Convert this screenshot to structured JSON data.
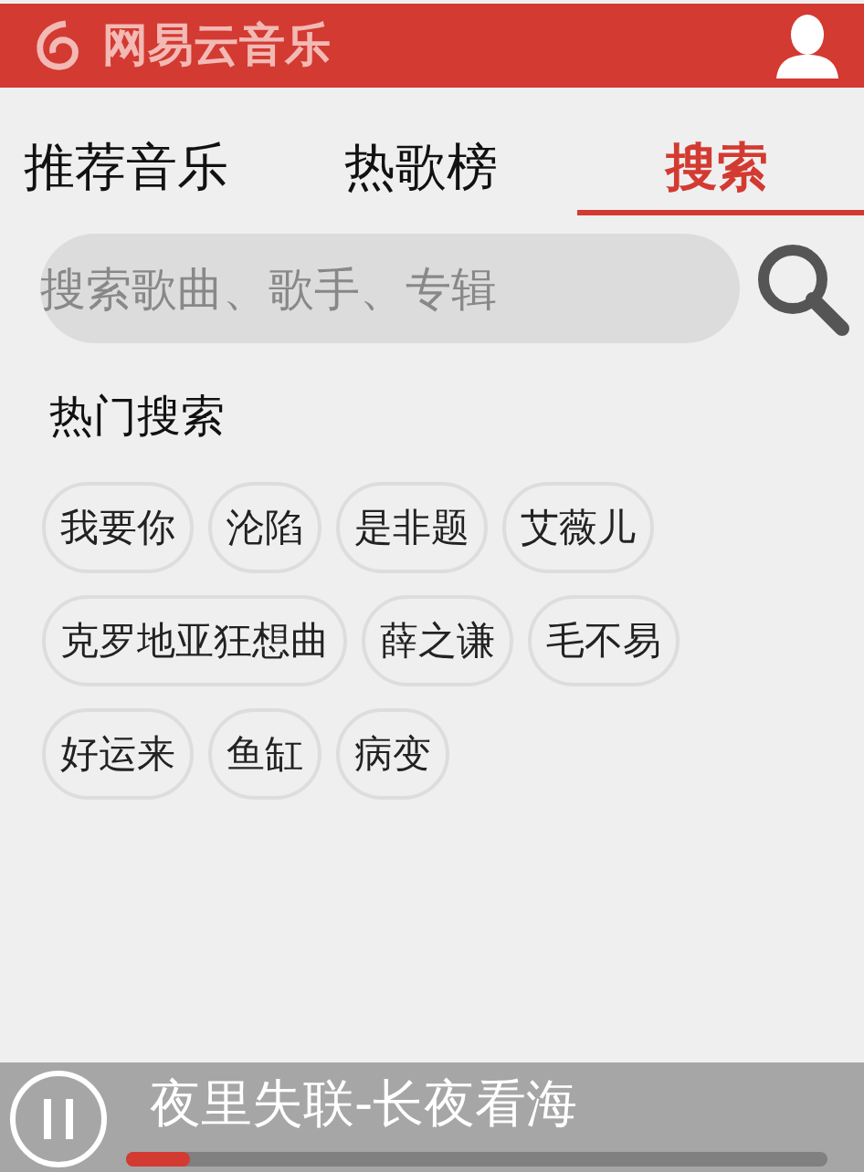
{
  "header": {
    "logo_text": "网易云音乐"
  },
  "tabs": [
    {
      "label": "推荐音乐",
      "selected": false
    },
    {
      "label": "热歌榜",
      "selected": false
    },
    {
      "label": "搜索",
      "selected": true
    }
  ],
  "search": {
    "placeholder": "搜索歌曲、歌手、专辑"
  },
  "hot_search": {
    "title": "热门搜索",
    "tags": [
      "我要你",
      "沦陷",
      "是非题",
      "艾薇儿",
      "克罗地亚狂想曲",
      "薛之谦",
      "毛不易",
      "好运来",
      "鱼缸",
      "病变"
    ]
  },
  "player": {
    "playing": true,
    "song": "夜里失联-长夜看海",
    "level": 0.09
  }
}
